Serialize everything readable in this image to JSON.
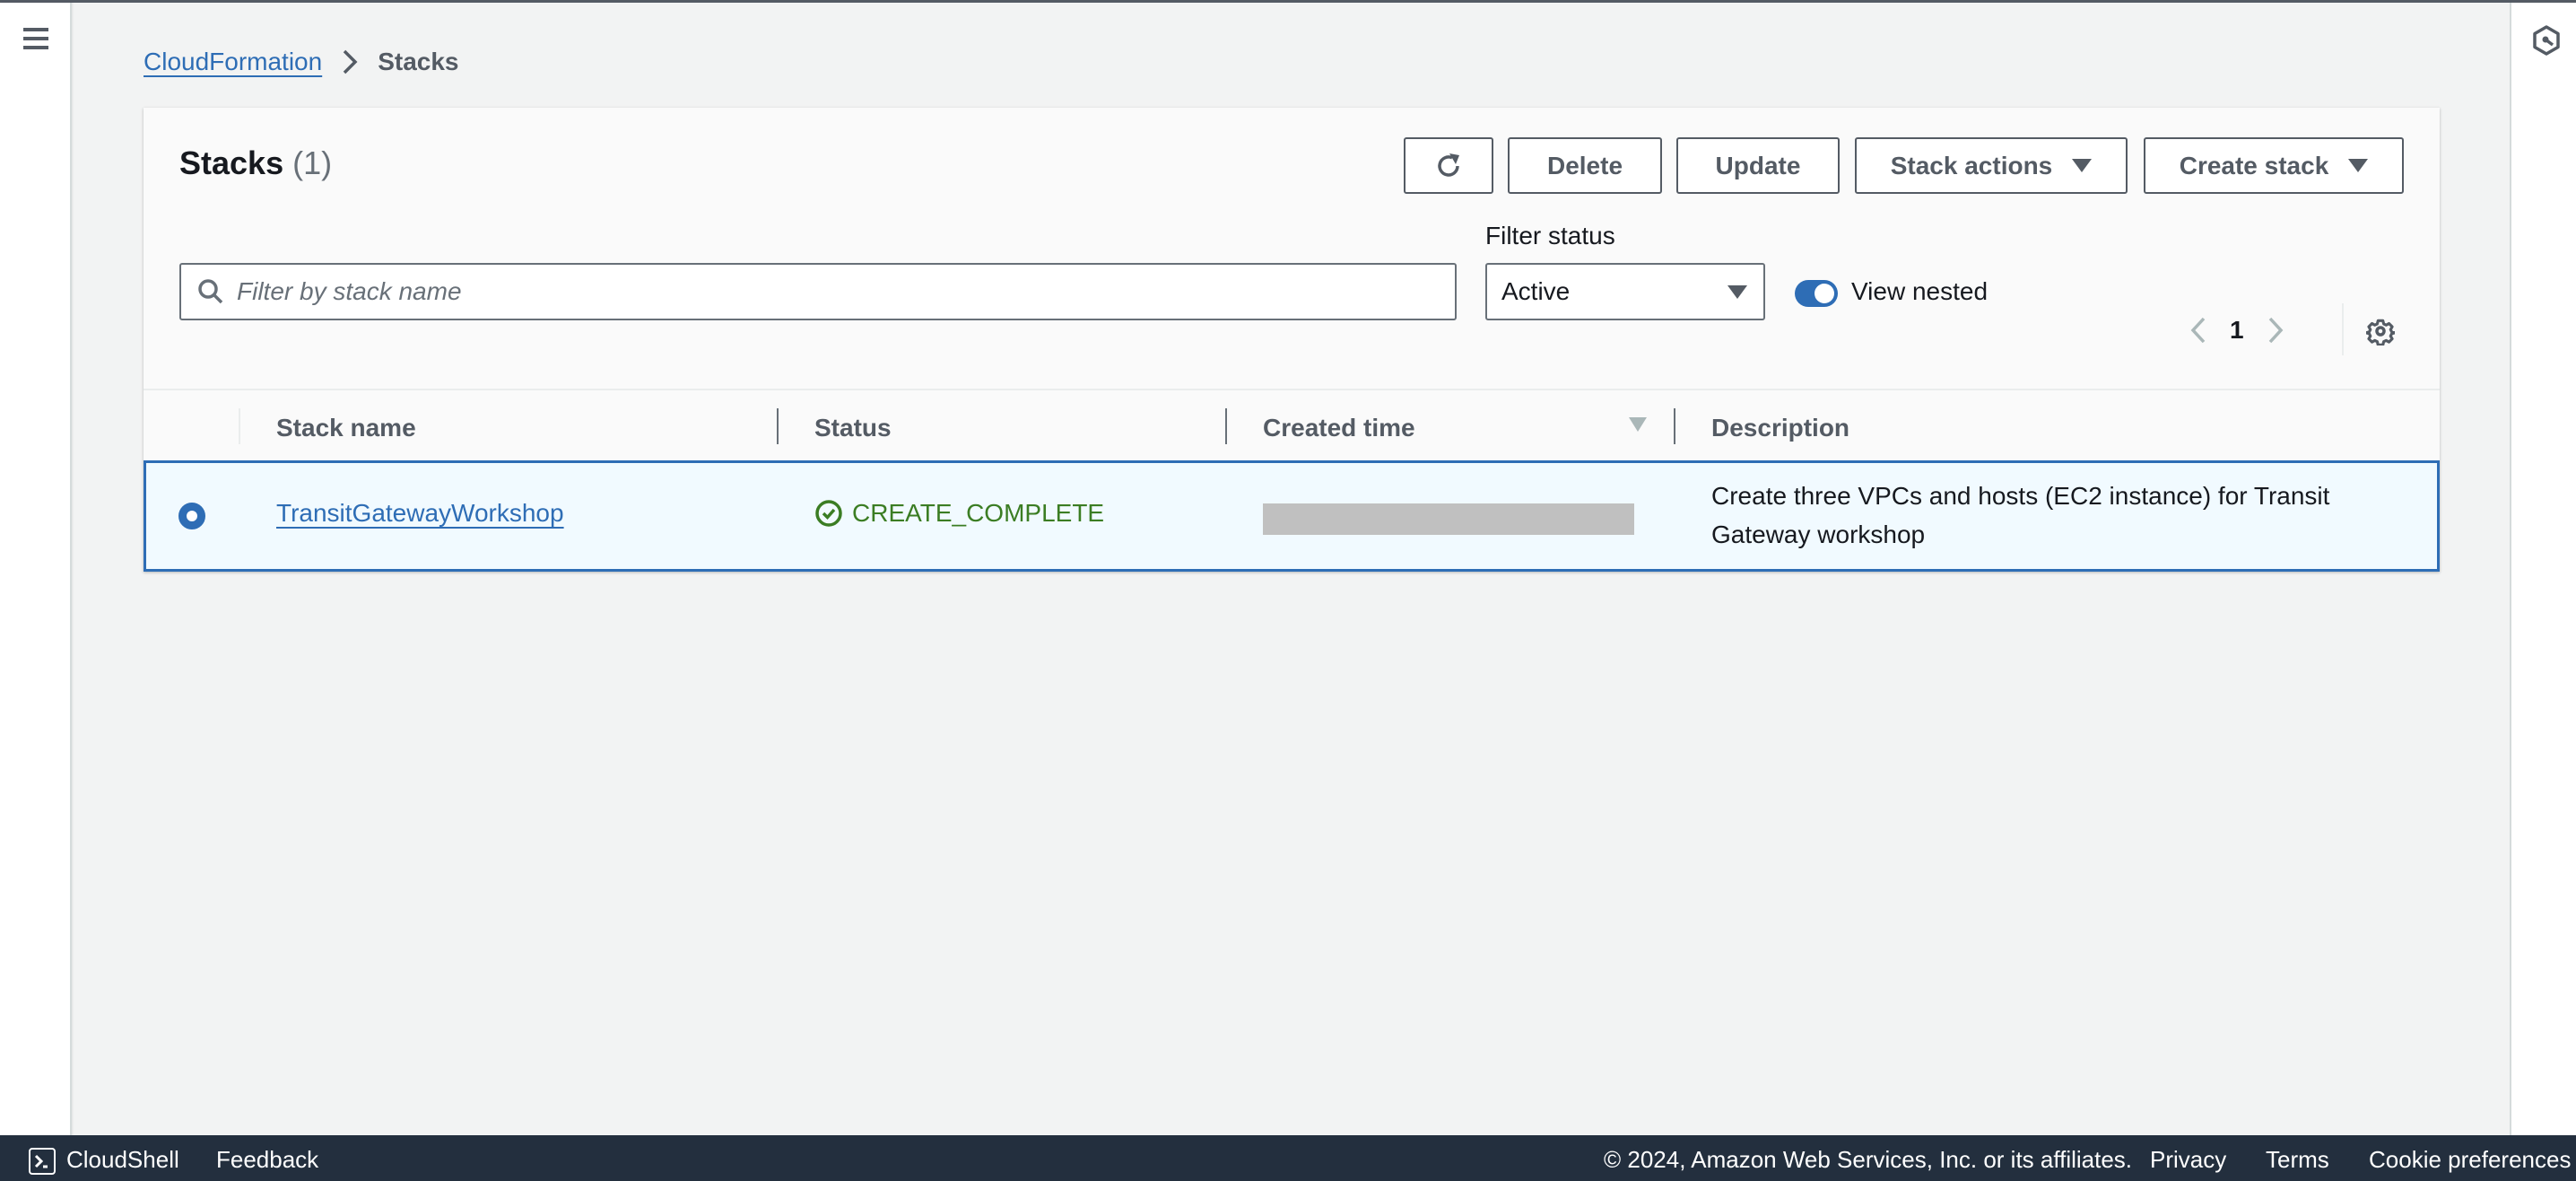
{
  "breadcrumb": {
    "items": [
      {
        "label": "CloudFormation",
        "link": true
      },
      {
        "label": "Stacks",
        "link": false
      }
    ]
  },
  "panel": {
    "title": "Stacks",
    "count": "(1)",
    "buttons": {
      "refresh_icon": "refresh-icon",
      "delete": "Delete",
      "update": "Update",
      "stack_actions": "Stack actions",
      "create_stack": "Create stack"
    },
    "search": {
      "placeholder": "Filter by stack name",
      "value": ""
    },
    "filter_status": {
      "label": "Filter status",
      "selected": "Active"
    },
    "view_nested": {
      "label": "View nested",
      "enabled": true
    },
    "pagination": {
      "current_page": "1"
    }
  },
  "table": {
    "columns": [
      "Stack name",
      "Status",
      "Created time",
      "Description"
    ],
    "sorted_column": "Created time",
    "sort_direction": "descending",
    "rows": [
      {
        "selected": true,
        "stack_name": "TransitGatewayWorkshop",
        "status": "CREATE_COMPLETE",
        "created_time": "",
        "created_time_redacted": true,
        "description": "Create three VPCs and hosts (EC2 instance) for Transit Gateway workshop"
      }
    ]
  },
  "footer": {
    "cloudshell": "CloudShell",
    "feedback": "Feedback",
    "copyright": "© 2024, Amazon Web Services, Inc. or its affiliates.",
    "privacy": "Privacy",
    "terms": "Terms",
    "cookie_preferences": "Cookie preferences"
  },
  "colors": {
    "accent": "#2e6db5",
    "success": "#3b7d23",
    "footer_bg": "#232f3e",
    "page_bg": "#f2f3f3"
  }
}
